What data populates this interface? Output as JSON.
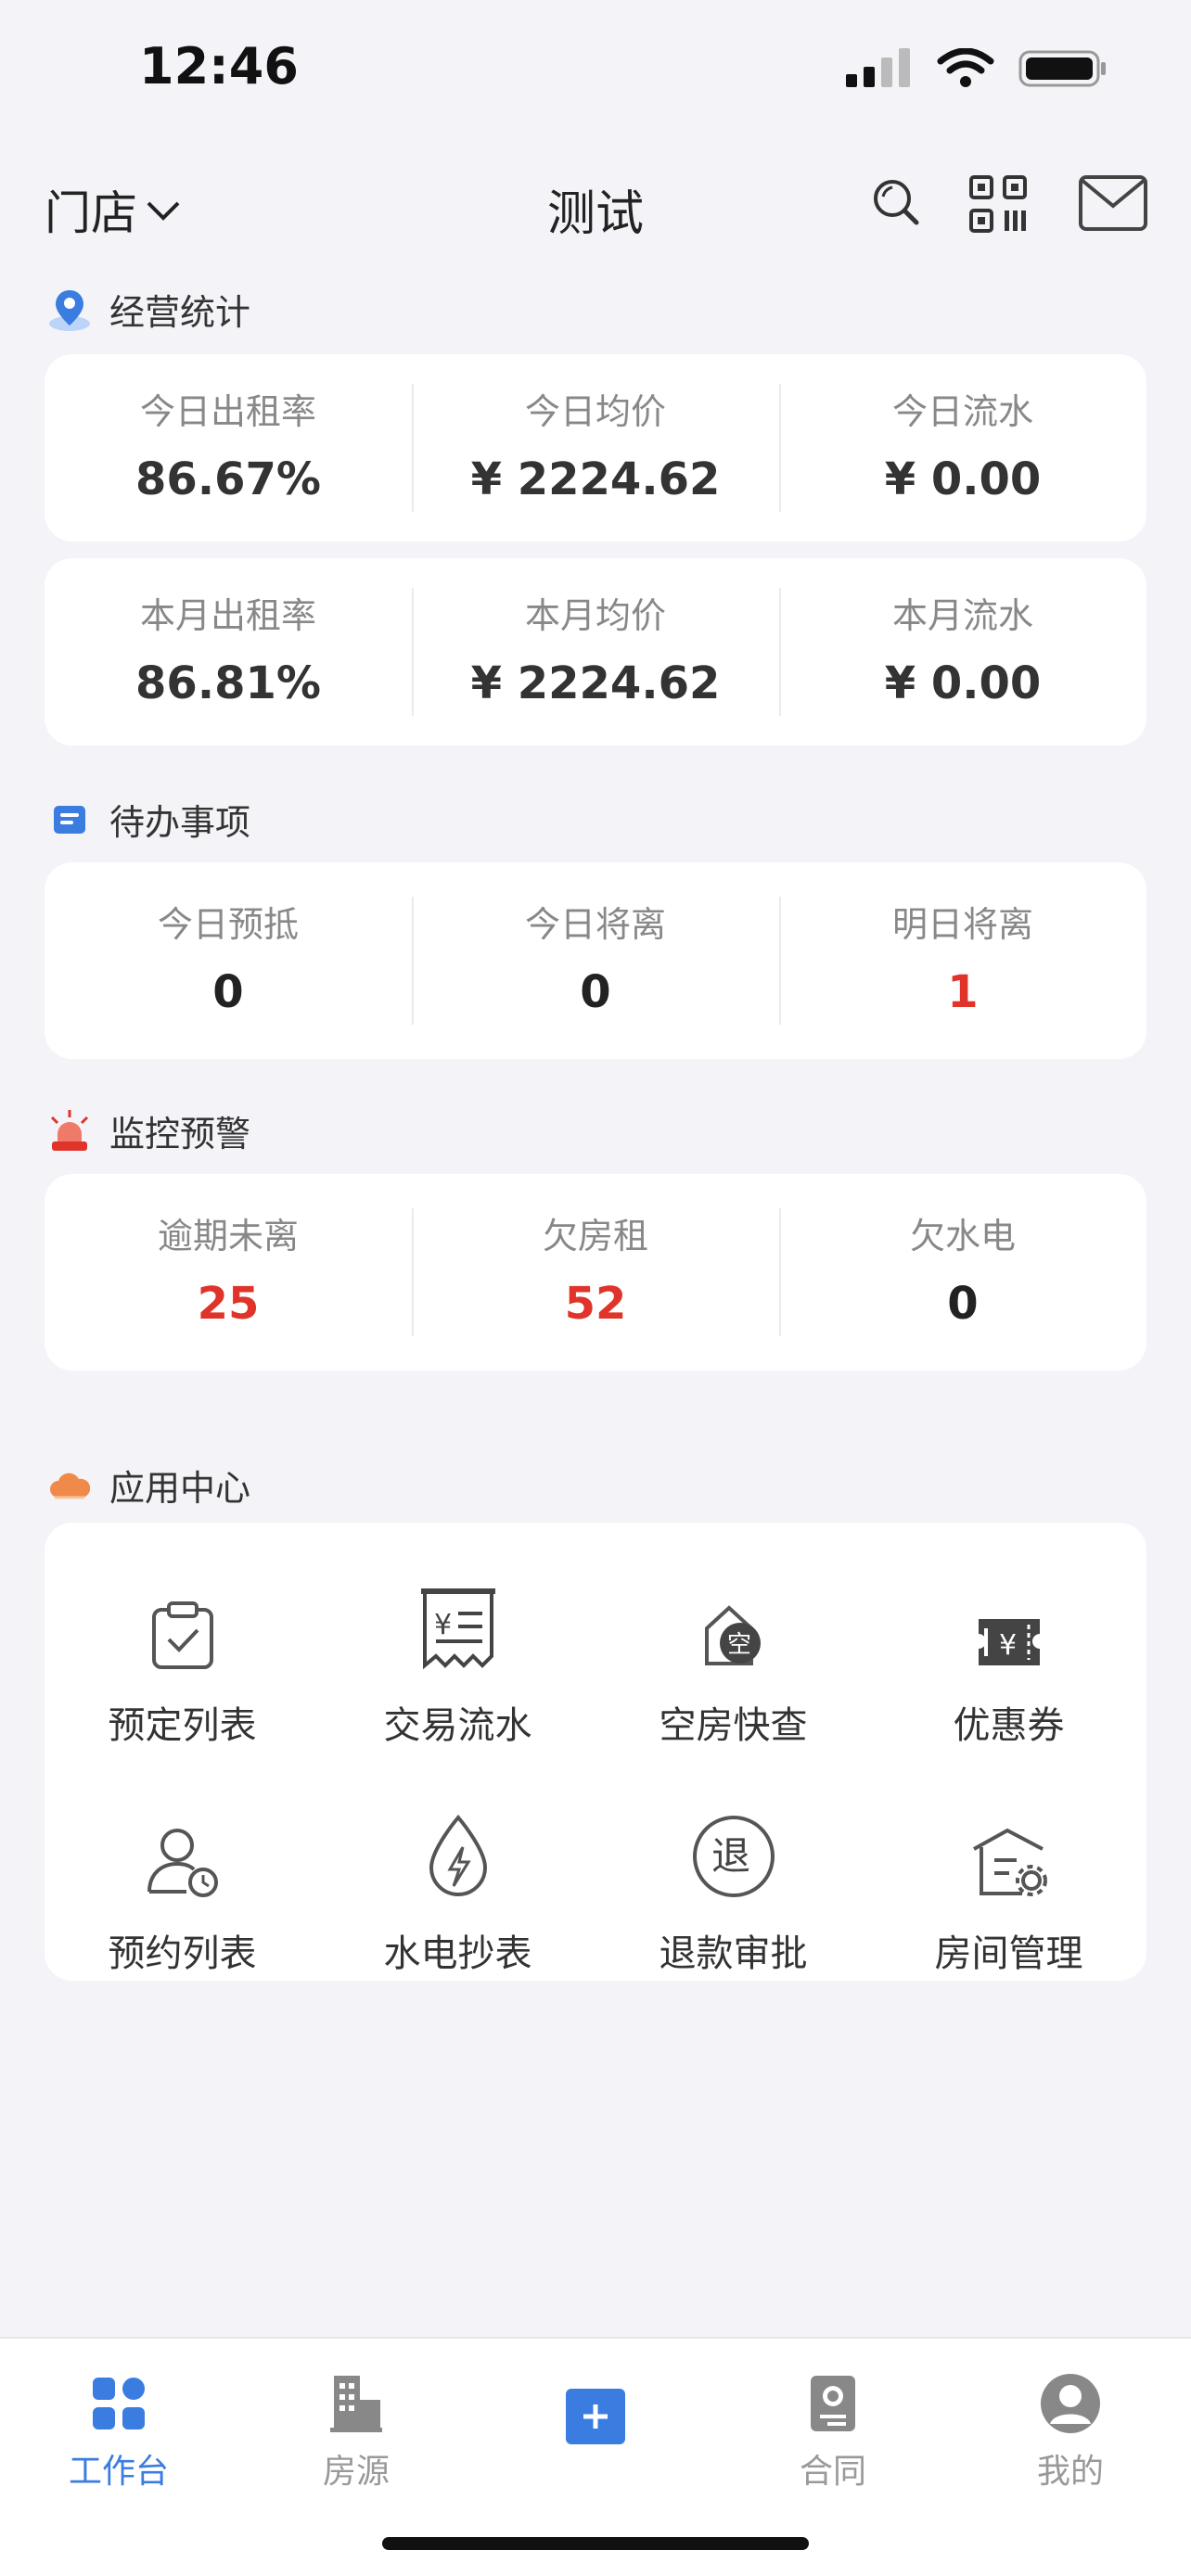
{
  "status_bar": {
    "time": "12:46"
  },
  "header": {
    "store_label": "门店",
    "title": "测试"
  },
  "business_stats": {
    "title": "经营统计",
    "today": [
      {
        "label": "今日出租率",
        "value": "86.67%"
      },
      {
        "label": "今日均价",
        "value": "¥ 2224.62"
      },
      {
        "label": "今日流水",
        "value": "¥ 0.00"
      }
    ],
    "month": [
      {
        "label": "本月出租率",
        "value": "86.81%"
      },
      {
        "label": "本月均价",
        "value": "¥ 2224.62"
      },
      {
        "label": "本月流水",
        "value": "¥ 0.00"
      }
    ]
  },
  "todo": {
    "title": "待办事项",
    "items": [
      {
        "label": "今日预抵",
        "value": "0",
        "alert": false
      },
      {
        "label": "今日将离",
        "value": "0",
        "alert": false
      },
      {
        "label": "明日将离",
        "value": "1",
        "alert": true
      }
    ]
  },
  "monitor": {
    "title": "监控预警",
    "items": [
      {
        "label": "逾期未离",
        "value": "25",
        "alert": true
      },
      {
        "label": "欠房租",
        "value": "52",
        "alert": true
      },
      {
        "label": "欠水电",
        "value": "0",
        "alert": false
      }
    ]
  },
  "apps": {
    "title": "应用中心",
    "items": [
      {
        "label": "预定列表",
        "icon": "clipboard-check-icon"
      },
      {
        "label": "交易流水",
        "icon": "receipt-yuan-icon"
      },
      {
        "label": "空房快查",
        "icon": "empty-room-icon"
      },
      {
        "label": "优惠券",
        "icon": "coupon-icon"
      },
      {
        "label": "预约列表",
        "icon": "user-clock-icon"
      },
      {
        "label": "水电抄表",
        "icon": "water-electric-icon"
      },
      {
        "label": "退款审批",
        "icon": "refund-icon"
      },
      {
        "label": "房间管理",
        "icon": "room-settings-icon"
      }
    ]
  },
  "tabs": [
    {
      "label": "工作台",
      "icon": "workbench-icon",
      "active": true
    },
    {
      "label": "房源",
      "icon": "building-icon",
      "active": false
    },
    {
      "label": "",
      "icon": "plus-icon",
      "active": false
    },
    {
      "label": "合同",
      "icon": "contract-icon",
      "active": false
    },
    {
      "label": "我的",
      "icon": "profile-icon",
      "active": false
    }
  ],
  "colors": {
    "accent": "#3a7ce0",
    "alert": "#e0332a",
    "background": "#f4f4f8"
  }
}
